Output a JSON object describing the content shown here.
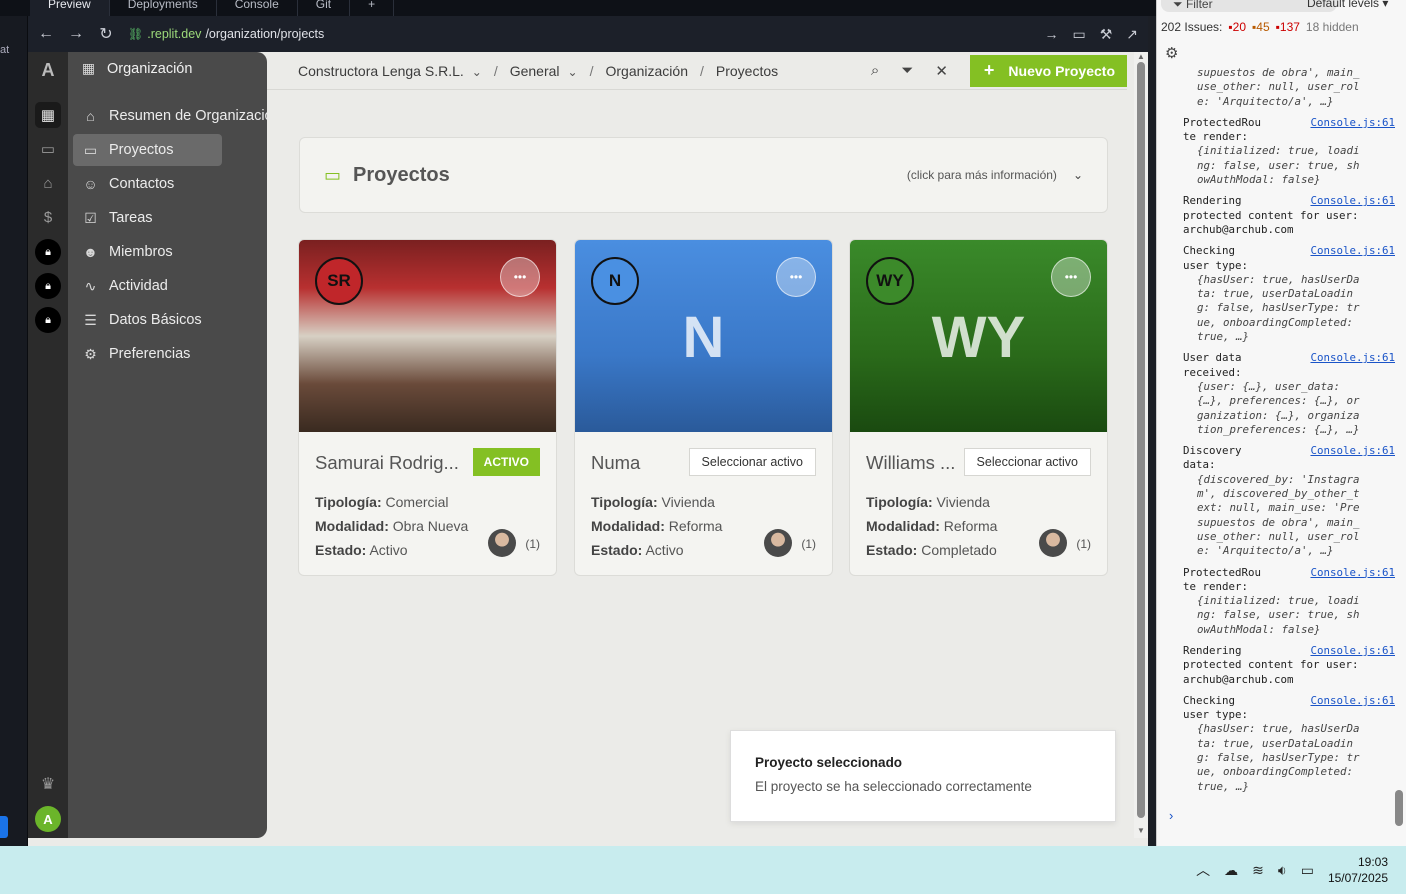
{
  "ide": {
    "tabs": [
      "Preview",
      "Deployments",
      "Console",
      "Git"
    ],
    "left_fragment": "at"
  },
  "browser": {
    "url_domain": ".replit.dev",
    "url_path": "/organization/projects"
  },
  "rail": {
    "logo": "A",
    "avatar_initial": "A"
  },
  "sidebar": {
    "header": "Organización",
    "items": [
      {
        "label": "Resumen de Organización",
        "icon": "home-icon"
      },
      {
        "label": "Proyectos",
        "icon": "folder-icon",
        "active": true
      },
      {
        "label": "Contactos",
        "icon": "contact-icon"
      },
      {
        "label": "Tareas",
        "icon": "check-square-icon"
      },
      {
        "label": "Miembros",
        "icon": "users-icon"
      },
      {
        "label": "Actividad",
        "icon": "activity-icon"
      },
      {
        "label": "Datos Básicos",
        "icon": "database-icon"
      },
      {
        "label": "Preferencias",
        "icon": "gear-icon"
      }
    ]
  },
  "topbar": {
    "org": "Constructora Lenga S.R.L.",
    "section": "General",
    "crumb1": "Organización",
    "crumb2": "Proyectos",
    "new_button": "Nuevo Proyecto"
  },
  "info_panel": {
    "title": "Proyectos",
    "hint": "(click para más información)"
  },
  "labels": {
    "tipologia": "Tipología:",
    "modalidad": "Modalidad:",
    "estado": "Estado:"
  },
  "projects": [
    {
      "initials": "SR",
      "name": "Samurai Rodrig...",
      "button": "ACTIVO",
      "tipologia": "Comercial",
      "modalidad": "Obra Nueva",
      "estado": "Activo",
      "members": "(1)"
    },
    {
      "initials": "N",
      "name": "Numa",
      "button": "Seleccionar activo",
      "tipologia": "Vivienda",
      "modalidad": "Reforma",
      "estado": "Activo",
      "members": "(1)"
    },
    {
      "initials": "WY",
      "name": "Williams ...",
      "button": "Seleccionar activo",
      "tipologia": "Vivienda",
      "modalidad": "Reforma",
      "estado": "Completado",
      "members": "(1)"
    }
  ],
  "toast": {
    "title": "Proyecto seleccionado",
    "message": "El proyecto se ha seleccionado correctamente"
  },
  "devtools": {
    "filter": "Filter",
    "levels": "Default levels ▾",
    "issues_label": "202 Issues:",
    "errors": "20",
    "warnings": "45",
    "info": "137",
    "hidden": "18 hidden",
    "source": "Console.js:61",
    "log": [
      {
        "head": "",
        "body": "supuestos de obra', main_\nuse_other: null, user_rol\ne: 'Arquitecto/a', …}"
      },
      {
        "head": "ProtectedRou\nte render:",
        "body": "{initialized: true, loadi\nng: false, user: true, sh\nowAuthModal: false}"
      },
      {
        "head": "Rendering\nprotected content for user:\narchub@archub.com",
        "body": ""
      },
      {
        "head": "Checking\nuser type:",
        "body": "{hasUser: true, hasUserDa\nta: true, userDataLoadin\ng: false, hasUserType: tr\nue, onboardingCompleted:\ntrue, …}"
      },
      {
        "head": "User data\nreceived:",
        "body": "{user: {…}, user_data:\n{…}, preferences: {…}, or\nganization: {…}, organiza\ntion_preferences: {…}, …}"
      },
      {
        "head": "Discovery\ndata:",
        "body": "{discovered_by: 'Instagra\nm', discovered_by_other_t\next: null, main_use: 'Pre\nsupuestos de obra', main_\nuse_other: null, user_rol\ne: 'Arquitecto/a', …}"
      },
      {
        "head": "ProtectedRou\nte render:",
        "body": "{initialized: true, loadi\nng: false, user: true, sh\nowAuthModal: false}"
      },
      {
        "head": "Rendering\nprotected content for user:\narchub@archub.com",
        "body": ""
      },
      {
        "head": "Checking\nuser type:",
        "body": "{hasUser: true, hasUserDa\nta: true, userDataLoadin\ng: false, hasUserType: tr\nue, onboardingCompleted:\ntrue, …}"
      }
    ]
  },
  "taskbar": {
    "time": "19:03",
    "date": "15/07/2025"
  }
}
